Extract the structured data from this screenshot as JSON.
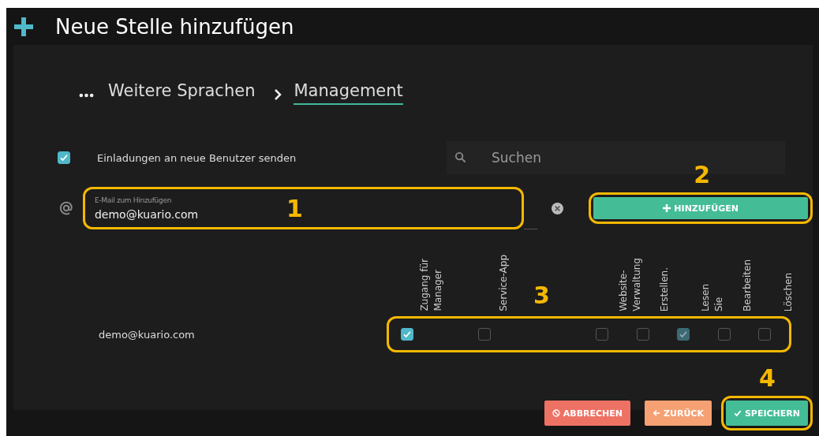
{
  "title": "Neue Stelle hinzufügen",
  "breadcrumb": [
    {
      "label": "Weitere Sprachen",
      "selected": false
    },
    {
      "label": "Management",
      "selected": true
    }
  ],
  "invite": {
    "label": "Einladungen an neue Benutzer senden",
    "checked": true
  },
  "search": {
    "placeholder": "Suchen"
  },
  "email_field": {
    "label": "E-Mail zum Hinzufügen",
    "value": "demo@kuario.com",
    "callout": "1"
  },
  "add_button": {
    "label": "HINZUFÜGEN",
    "callout": "2"
  },
  "permissions": {
    "columns": [
      "Zugang für\nManager",
      "Service-App",
      "Website-\nVerwaltung",
      "Erstellen.",
      "Lesen\nSie",
      "Bearbeiten",
      "Löschen"
    ],
    "callout": "3",
    "rows": [
      {
        "email": "demo@kuario.com",
        "checks": [
          {
            "checked": true,
            "disabled": false
          },
          {
            "checked": false,
            "disabled": false
          },
          {
            "checked": false,
            "disabled": false
          },
          {
            "checked": false,
            "disabled": false
          },
          {
            "checked": true,
            "disabled": true
          },
          {
            "checked": false,
            "disabled": false
          },
          {
            "checked": false,
            "disabled": false
          }
        ]
      }
    ]
  },
  "actions": [
    {
      "kind": "cancel",
      "label": "ABBRECHEN"
    },
    {
      "kind": "back",
      "label": "ZURÜCK"
    },
    {
      "kind": "save",
      "label": "SPEICHERN",
      "callout": "4"
    }
  ]
}
